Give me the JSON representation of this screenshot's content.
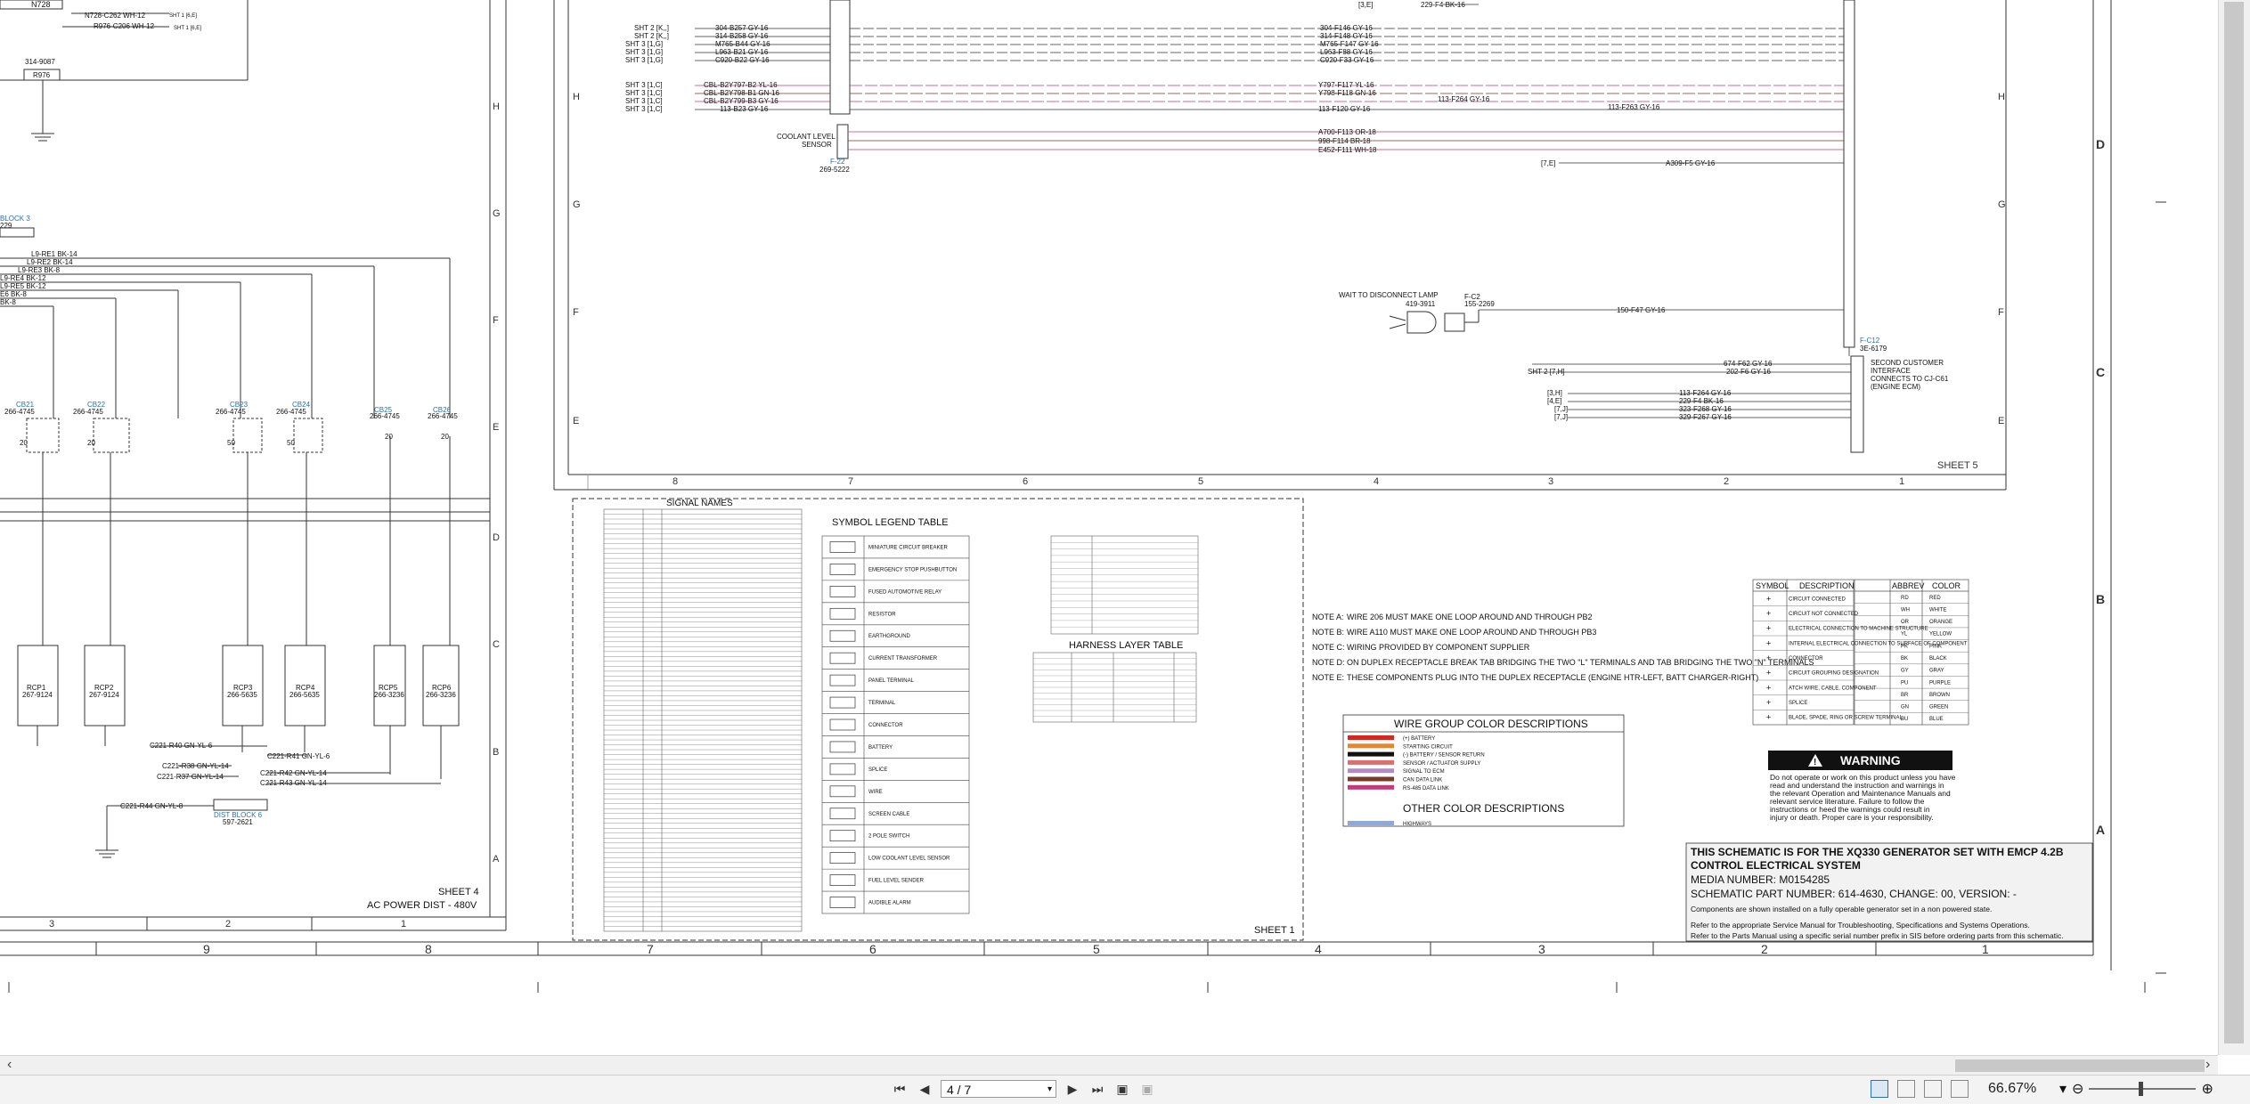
{
  "document": {
    "sheet4": {
      "label": "SHEET 4",
      "sublabel": "AC POWER DIST - 480V"
    },
    "sheet5": {
      "label": "SHEET 5"
    },
    "sheet1": {
      "label": "SHEET 1"
    },
    "row_letters_left": [
      "H",
      "G",
      "F",
      "E",
      "D",
      "C",
      "B",
      "A"
    ],
    "row_letters_mid": [
      "H",
      "G",
      "F",
      "E"
    ],
    "row_letters_right": [
      "D",
      "C",
      "B",
      "A"
    ],
    "col_numbers_sheet4": [
      "3",
      "2",
      "1"
    ],
    "col_numbers_sheet5": [
      "8",
      "7",
      "6",
      "5",
      "4",
      "3",
      "2",
      "1"
    ],
    "col_numbers_bottom": [
      "9",
      "8",
      "7",
      "6",
      "5",
      "4",
      "3",
      "2",
      "1"
    ],
    "top_labels": {
      "n728": "N728",
      "n728_wire": "N728-C262 WH-12",
      "r976_wire": "R976-C206 WH-12",
      "sht1_a": "SHT 1 [6,E]",
      "sht1_b": "SHT 1 [6,E]",
      "part314": "314-9087",
      "r976": "R976",
      "block3": "BLOCK 3",
      "block3_pn": "229"
    },
    "le_wires": [
      "L9-RE1 BK-14",
      "L9-RE2 BK-14",
      "L9-RE3 BK-8",
      "L9-RE4 BK-12",
      "L9-RE5 BK-12",
      "E6 BK-8",
      "BK-8"
    ],
    "cb_labels": [
      {
        "id": "CB21",
        "pn": "266-4745",
        "rating": "20"
      },
      {
        "id": "CB22",
        "pn": "266-4745",
        "rating": "20"
      },
      {
        "id": "CB23",
        "pn": "266-4745",
        "rating": "50"
      },
      {
        "id": "CB24",
        "pn": "266-4745",
        "rating": "50"
      },
      {
        "id": "CB25",
        "pn": "266-4745",
        "rating": "20"
      },
      {
        "id": "CB26",
        "pn": "266-4745",
        "rating": "20"
      }
    ],
    "rcp_labels": [
      {
        "id": "RCP1",
        "pn": "267-9124"
      },
      {
        "id": "RCP2",
        "pn": "267-9124"
      },
      {
        "id": "RCP3",
        "pn": "266-5635"
      },
      {
        "id": "RCP4",
        "pn": "266-5635"
      },
      {
        "id": "RCP5",
        "pn": "266-3236"
      },
      {
        "id": "RCP6",
        "pn": "266-3236"
      }
    ],
    "bottom_wires": [
      "C221-R40 GN-YL-6",
      "C221-R38 GN-YL-14",
      "C221-R37 GN-YL-14",
      "C221-R41 GN-YL-6",
      "C221-R42 GN-YL-14",
      "C221-R43 GN-YL-14",
      "C221-R44 GN-YL-8"
    ],
    "dist_block": {
      "label": "DIST BLOCK 6",
      "pn": "597-2621"
    },
    "sht_refs_top": [
      "SHT 2 [K,,]",
      "SHT 2 [K,,]",
      "SHT 3 [1,G]",
      "SHT 3 [1,G]",
      "SHT 3 [1,G]"
    ],
    "wires_left_top": [
      "304-B257 GY-16",
      "314-B258 GY-16",
      "M765-B44 GY-16",
      "L963-B21 GY-16",
      "C920-B22 GY-16"
    ],
    "sht_refs_mid": [
      "SHT 3 [1,C]",
      "SHT 3 [1,C]",
      "SHT 3 [1,C]",
      "SHT 3 [1,C]"
    ],
    "wires_left_mid": [
      "CBL-B2Y797-B2 YL-16",
      "CBL-B2Y798-B1 GN-16",
      "CBL-B2Y799-B3 GY-16",
      "113-B23 GY-16"
    ],
    "wires_right_top": [
      "304-F146 GY-16",
      "314-F148 GY-16",
      "M765-F147 GY-16",
      "L963-F88 GY-16",
      "C920-F33 GY-16"
    ],
    "wires_right_mid": [
      "Y797-F117 YL-16",
      "Y798-F118 GN-16",
      "113-F120 GY-16",
      "113-F264 GY-16",
      "113-F263 GY-16"
    ],
    "top_right_labels": {
      "ref": "[3,E]",
      "wire": "229-F4 BK-16"
    },
    "coolant": {
      "label1": "COOLANT LEVEL",
      "label2": "SENSOR",
      "id": "F-22",
      "pn": "269-5222"
    },
    "wires_coolant": [
      "A700-F113 OR-18",
      "998-F114 BR-18",
      "E452-F111 WH-18"
    ],
    "ref_7e": "[7,E]",
    "wire_a309": "A309-F5 GY-16",
    "lamp": {
      "label": "WAIT TO DISCONNECT LAMP",
      "pn": "419-3911",
      "conn": "F-C2",
      "conn_pn": "155-2269",
      "wire": "150-F47 GY-16"
    },
    "connector_main": {
      "id": "F-C12",
      "pn": "3E-6179"
    },
    "second_interface": [
      "SECOND CUSTOMER",
      "INTERFACE",
      "CONNECTS TO CJ-C61",
      "(ENGINE ECM)"
    ],
    "wires_bottom_right": [
      "674-F62 GY-16",
      "202-F6 GY-16",
      "113-F264 GY-16",
      "229-F4 BK-16",
      "323-F268 GY-16",
      "329-F267 GY-16"
    ],
    "sht2_ref": "SHT 2 [7,H]",
    "refs_small": [
      "[3,H]",
      "[4,E]",
      "[7,J]",
      "[7,J]"
    ],
    "signal_names_title": "SIGNAL NAMES",
    "signal_rows": 86,
    "symbol_legend": {
      "title": "SYMBOL LEGEND TABLE",
      "items": [
        "MINIATURE CIRCUIT BREAKER",
        "EMERGENCY STOP PUSHBUTTON",
        "FUSED AUTOMOTIVE RELAY",
        "RESISTOR",
        "EARTHGROUND",
        "CURRENT TRANSFORMER",
        "PANEL TERMINAL",
        "TERMINAL",
        "CONNECTOR",
        "BATTERY",
        "SPLICE",
        "WIRE",
        "SCREEN CABLE",
        "2 POLE SWITCH",
        "LOW COOLANT LEVEL SENSOR",
        "FUEL LEVEL SENDER",
        "AUDIBLE ALARM"
      ]
    },
    "harness_title": "HARNESS LAYER TABLE",
    "notes": [
      {
        "key": "NOTE A:",
        "text": "WIRE 206 MUST MAKE ONE LOOP AROUND AND THROUGH PB2"
      },
      {
        "key": "NOTE B:",
        "text": "WIRE A110 MUST MAKE ONE LOOP AROUND AND THROUGH PB3"
      },
      {
        "key": "NOTE C:",
        "text": "WIRING PROVIDED BY COMPONENT SUPPLIER"
      },
      {
        "key": "NOTE D:",
        "text": "ON DUPLEX RECEPTACLE BREAK TAB BRIDGING THE TWO \"L\" TERMINALS AND TAB BRIDGING THE TWO \"N\" TERMINALS"
      },
      {
        "key": "NOTE E:",
        "text": "THESE COMPONENTS PLUG INTO THE DUPLEX RECEPTACLE (ENGINE HTR-LEFT, BATT CHARGER-RIGHT)"
      }
    ],
    "wire_group": {
      "title": "WIRE GROUP COLOR DESCRIPTIONS",
      "items": [
        {
          "label": "(+) BATTERY",
          "color": "#d9261c"
        },
        {
          "label": "STARTING CIRCUIT",
          "color": "#e8862a"
        },
        {
          "label": "(-) BATTERY / SENSOR RETURN",
          "color": "#111111"
        },
        {
          "label": "SENSOR / ACTUATOR SUPPLY",
          "color": "#d96f6f"
        },
        {
          "label": "SIGNAL TO ECM",
          "color": "#b58ac9"
        },
        {
          "label": "CAN DATA LINK",
          "color": "#7a3a2a"
        },
        {
          "label": "RS-485 DATA LINK",
          "color": "#c23a7a"
        }
      ],
      "other_title": "OTHER COLOR DESCRIPTIONS",
      "other_items": [
        {
          "label": "HIGHWAYS",
          "color": "#8fa8d6"
        }
      ]
    },
    "symbol_table": {
      "headers": [
        "SYMBOL",
        "DESCRIPTION"
      ],
      "rows": [
        "CIRCUIT CONNECTED",
        "CIRCUIT NOT CONNECTED",
        "ELECTRICAL CONNECTION TO MACHINE STRUCTURE",
        "INTERNAL ELECTRICAL CONNECTION TO SURFACE OF COMPONENT",
        "CONNECTOR",
        "CIRCUIT GROUPING DESIGNATION",
        "ATCH WIRE, CABLE, COMPONENT",
        "SPLICE",
        "BLADE, SPADE, RING OR SCREW TERMINAL"
      ]
    },
    "abbrev_table": {
      "headers": [
        "ABBREV",
        "COLOR"
      ],
      "rows": [
        [
          "RD",
          "RED"
        ],
        [
          "WH",
          "WHITE"
        ],
        [
          "OR",
          "ORANGE"
        ],
        [
          "YL",
          "YELLOW"
        ],
        [
          "PK",
          "PINK"
        ],
        [
          "BK",
          "BLACK"
        ],
        [
          "GY",
          "GRAY"
        ],
        [
          "PU",
          "PURPLE"
        ],
        [
          "BR",
          "BROWN"
        ],
        [
          "GN",
          "GREEN"
        ],
        [
          "BU",
          "BLUE"
        ]
      ]
    },
    "warning": {
      "title": "WARNING",
      "text": "Do not operate or work on this product unless you have read and understand the instruction and warnings in the relevant Operation and Maintenance Manuals and relevant service literature. Failure to follow the instructions or heed the warnings could result in injury or death. Proper care is your responsibility."
    },
    "title_block": {
      "line1": "THIS SCHEMATIC IS FOR THE XQ330 GENERATOR SET WITH EMCP 4.2B",
      "line2": "CONTROL ELECTRICAL SYSTEM",
      "media": "MEDIA NUMBER: M0154285",
      "part": "SCHEMATIC PART NUMBER: 614-4630, CHANGE: 00, VERSION: -",
      "note1": "Components are shown installed on a fully operable generator set in a non powered state.",
      "note2": "Refer to the appropriate Service Manual for Troubleshooting, Specifications and Systems Operations.",
      "note3": "Refer to the Parts Manual using a specific serial number prefix in SIS before ordering parts from this schematic."
    }
  },
  "viewer": {
    "page_field": "4 / 7",
    "zoom": "66.67%",
    "icons": [
      "first-page-icon",
      "prev-page-icon",
      "next-page-icon",
      "last-page-icon"
    ]
  }
}
